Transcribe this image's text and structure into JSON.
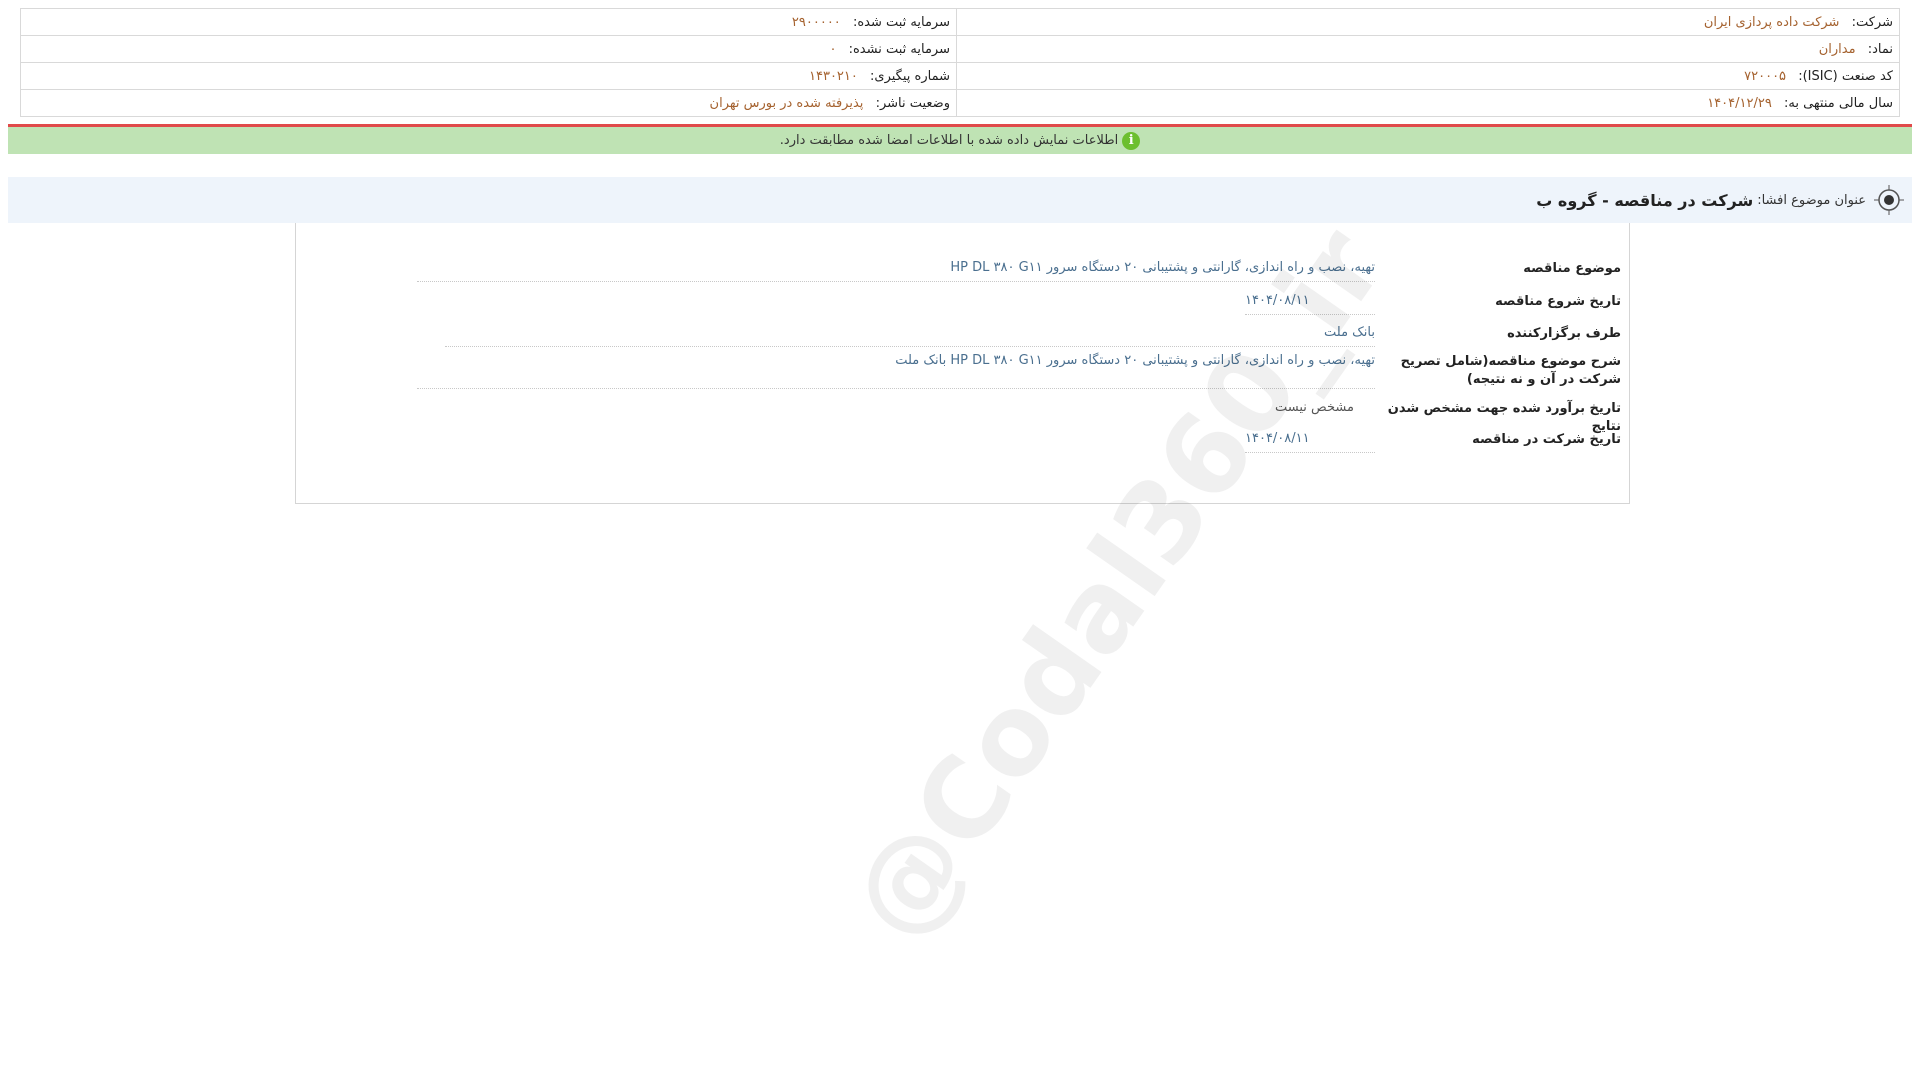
{
  "header": {
    "company_label": "شرکت:",
    "company_value": "شرکت داده پردازی ایران",
    "registered_capital_label": "سرمایه ثبت شده:",
    "registered_capital_value": "۲۹۰۰۰۰۰",
    "symbol_label": "نماد:",
    "symbol_value": "مداران",
    "unregistered_capital_label": "سرمایه ثبت نشده:",
    "unregistered_capital_value": "۰",
    "isic_label": "کد صنعت (ISIC):",
    "isic_value": "۷۲۰۰۰۵",
    "tracking_label": "شماره پیگیری:",
    "tracking_value": "۱۴۳۰۲۱۰",
    "fiscal_year_label": "سال مالی منتهی به:",
    "fiscal_year_value": "۱۴۰۴/۱۲/۲۹",
    "publisher_status_label": "وضعیت ناشر:",
    "publisher_status_value": "پذیرفته شده در بورس تهران"
  },
  "verify": {
    "icon": "info-icon",
    "message": "اطلاعات نمایش داده شده با اطلاعات امضا شده مطابقت دارد."
  },
  "title": {
    "icon": "target-icon",
    "label": "عنوان موضوع افشا:",
    "value": "شرکت در مناقصه - گروه ب"
  },
  "details": [
    {
      "label": "موضوع مناقصه",
      "value": "تهیه، نصب و راه اندازی، گارانتی و پشتیبانی ۲۰ دستگاه سرور HP DL ۳۸۰ G۱۱"
    },
    {
      "label": "تاریخ شروع مناقصه",
      "value": "۱۴۰۴/۰۸/۱۱"
    },
    {
      "label": "طرف برگزارکننده",
      "value": "بانک ملت"
    },
    {
      "label": "شرح موضوع مناقصه(شامل تصریح شرکت در آن و نه نتیجه)",
      "value": "تهیه، نصب و راه اندازی، گارانتی و پشتیبانی ۲۰ دستگاه سرور HP DL ۳۸۰ G۱۱ بانک ملت"
    },
    {
      "label": "تاریخ برآورد شده جهت مشخص شدن نتایج",
      "value": "مشخص نیست"
    },
    {
      "label": "تاریخ شرکت در مناقصه",
      "value": "۱۴۰۴/۰۸/۱۱"
    }
  ],
  "watermark": "@Codal360_ir"
}
